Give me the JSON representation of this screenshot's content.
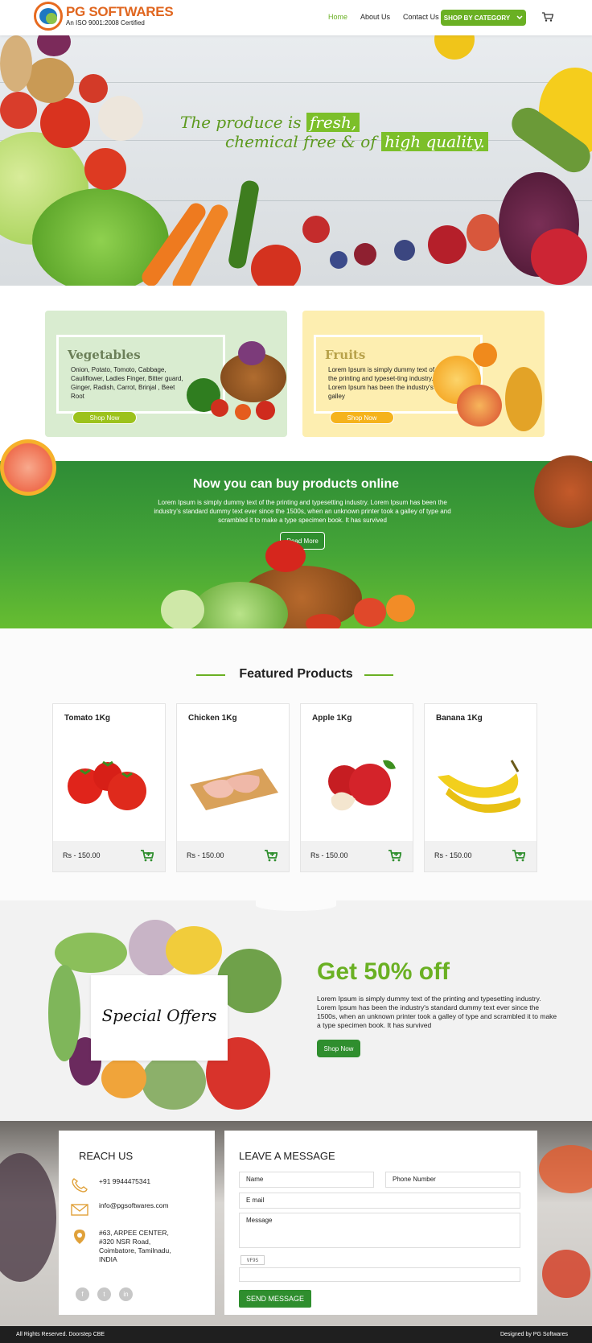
{
  "header": {
    "brand": "PG SOFTWARES",
    "cert": "An ISO 9001:2008 Certified",
    "nav": [
      "Home",
      "About Us",
      "Contact Us"
    ],
    "category_button": "SHOP BY CATEGORY",
    "accent": "#6ab023"
  },
  "hero": {
    "line1_pre": "The produce is",
    "line1_hl": "fresh,",
    "line2_pre": "chemical free & of",
    "line2_hl": "high quality."
  },
  "categories": [
    {
      "title": "Vegetables",
      "desc": "Onion, Potato, Tomoto, Cabbage, Cauliflower, Ladies Finger, Bitter guard, Ginger, Radish, Carrot, Brinjal , Beet Root",
      "button": "Shop Now",
      "bg": "#d9ecd0",
      "title_color": "#6b7f58"
    },
    {
      "title": "Fruits",
      "desc": "Lorem Ipsum is simply dummy text of the printing and typeset-ting industry. Lorem Ipsum has been the industry's galley",
      "button": "Shop Now",
      "bg": "#fdeeb0",
      "title_color": "#b8a24a"
    }
  ],
  "banner": {
    "title": "Now you can buy products online",
    "text": "Lorem Ipsum is simply dummy text of the printing and typesetting industry. Lorem Ipsum has been the industry's standard dummy text ever since the 1500s, when an unknown printer took a galley of type and scrambled it to make a type specimen book. It has survived",
    "button": "Read More"
  },
  "featured": {
    "title": "Featured Products",
    "products": [
      {
        "name": "Tomato 1Kg",
        "price": "Rs - 150.00",
        "icon": "tomato"
      },
      {
        "name": "Chicken 1Kg",
        "price": "Rs - 150.00",
        "icon": "chicken"
      },
      {
        "name": "Apple 1Kg",
        "price": "Rs - 150.00",
        "icon": "apple"
      },
      {
        "name": "Banana 1Kg",
        "price": "Rs - 150.00",
        "icon": "banana"
      }
    ]
  },
  "offers": {
    "card": "Special Offers",
    "title": "Get 50% off",
    "text": "Lorem Ipsum is simply dummy text of the printing and typesetting industry. Lorem Ipsum has been the industry's standard dummy text ever since the 1500s, when an unknown printer took a galley of type and scrambled it to make a type specimen book. It has survived",
    "button": "Shop Now"
  },
  "contact": {
    "reach_title": "REACH US",
    "phone": "+91 9944475341",
    "email": "info@pgsoftwares.com",
    "address": [
      "#63, ARPEE CENTER,",
      "#320 NSR Road,",
      "Coimbatore, Tamilnadu,",
      "INDIA"
    ],
    "social": [
      "f",
      "t",
      "in"
    ],
    "message_title": "LEAVE A MESSAGE",
    "fields": {
      "name": "Name",
      "phone": "Phone Number",
      "email": "E mail",
      "message": "Message"
    },
    "captcha": "VF9S",
    "send": "SEND MESSAGE"
  },
  "footer": {
    "left": "All Rights Reserved. Doorstep CBE",
    "right": "Designed by PG Softwares"
  }
}
